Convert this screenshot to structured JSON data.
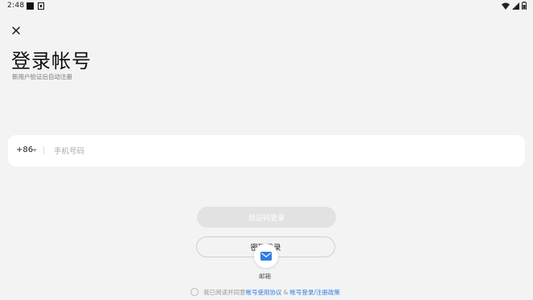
{
  "status_bar": {
    "time": "2:48",
    "notification_icons": [
      "square-icon",
      "photo-icon"
    ],
    "right_icons": [
      "wifi-icon",
      "signal-icon",
      "battery-icon"
    ]
  },
  "header": {
    "close_icon": "close-icon",
    "title": "登录帐号",
    "subtitle": "新用户验证后自动注册"
  },
  "phone_form": {
    "country_code": "+86",
    "phone_value": "",
    "phone_placeholder": "手机号码"
  },
  "actions": {
    "code_login_label": "验证码登录",
    "password_login_label": "密码登录"
  },
  "email_option": {
    "icon": "mail-icon",
    "label": "邮箱",
    "accent_color": "#2f7de1"
  },
  "agreement": {
    "prefix": "我已阅读并同意",
    "link_1": "帐号使用协议",
    "separator": "&",
    "link_2": "帐号登录/注册政策"
  }
}
